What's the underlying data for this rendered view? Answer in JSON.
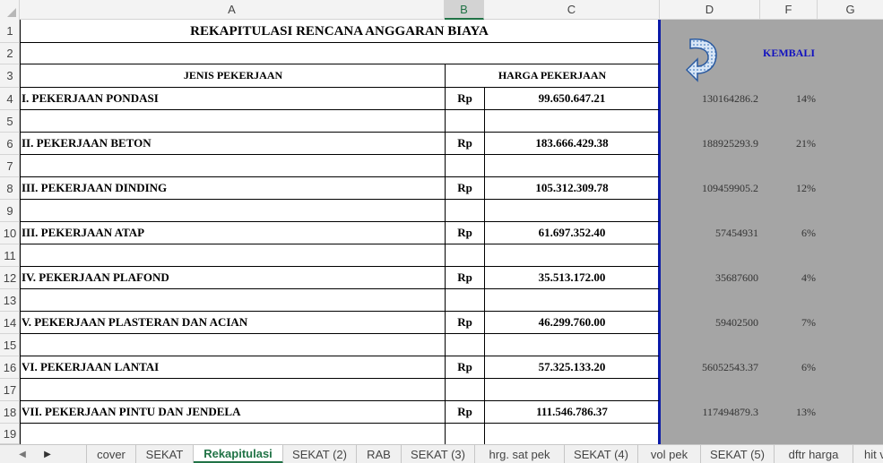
{
  "columns": [
    {
      "label": "A",
      "selected": false
    },
    {
      "label": "B",
      "selected": true
    },
    {
      "label": "C",
      "selected": false
    },
    {
      "label": "D",
      "selected": false
    },
    {
      "label": "F",
      "selected": false
    },
    {
      "label": "G",
      "selected": false
    }
  ],
  "rows": [
    "1",
    "2",
    "3",
    "4",
    "5",
    "6",
    "7",
    "8",
    "9",
    "10",
    "11",
    "12",
    "13",
    "14",
    "15",
    "16",
    "17",
    "18",
    "19"
  ],
  "sheet": {
    "title": "REKAPITULASI RENCANA ANGGARAN BIAYA",
    "header_jenis": "JENIS PEKERJAAN",
    "header_harga": "HARGA PEKERJAAN",
    "items": [
      {
        "name": "I. PEKERJAAN PONDASI",
        "currency": "Rp",
        "amount": "99.650.647.21",
        "d_value": "130164286.2",
        "percent": "14%"
      },
      {
        "name": "II. PEKERJAAN BETON",
        "currency": "Rp",
        "amount": "183.666.429.38",
        "d_value": "188925293.9",
        "percent": "21%"
      },
      {
        "name": "III. PEKERJAAN DINDING",
        "currency": "Rp",
        "amount": "105.312.309.78",
        "d_value": "109459905.2",
        "percent": "12%"
      },
      {
        "name": "III. PEKERJAAN ATAP",
        "currency": "Rp",
        "amount": "61.697.352.40",
        "d_value": "57454931",
        "percent": "6%"
      },
      {
        "name": "IV. PEKERJAAN PLAFOND",
        "currency": "Rp",
        "amount": "35.513.172.00",
        "d_value": "35687600",
        "percent": "4%"
      },
      {
        "name": "V. PEKERJAAN PLASTERAN DAN ACIAN",
        "currency": "Rp",
        "amount": "46.299.760.00",
        "d_value": "59402500",
        "percent": "7%"
      },
      {
        "name": "VI. PEKERJAAN LANTAI",
        "currency": "Rp",
        "amount": "57.325.133.20",
        "d_value": "56052543.37",
        "percent": "6%"
      },
      {
        "name": "VII. PEKERJAAN PINTU DAN JENDELA",
        "currency": "Rp",
        "amount": "111.546.786.37",
        "d_value": "117494879.3",
        "percent": "13%"
      }
    ]
  },
  "kembali_label": "KEMBALI",
  "tabs": [
    {
      "label": "cover",
      "active": false
    },
    {
      "label": "SEKAT",
      "active": false
    },
    {
      "label": "Rekapitulasi",
      "active": true
    },
    {
      "label": "SEKAT (2)",
      "active": false
    },
    {
      "label": "RAB",
      "active": false
    },
    {
      "label": "SEKAT (3)",
      "active": false
    },
    {
      "label": "hrg. sat pek",
      "active": false
    },
    {
      "label": "SEKAT (4)",
      "active": false
    },
    {
      "label": "vol pek",
      "active": false
    },
    {
      "label": "SEKAT (5)",
      "active": false
    },
    {
      "label": "dftr harga",
      "active": false
    },
    {
      "label": "hit v",
      "active": false
    }
  ],
  "colors": {
    "accent": "#217346",
    "gray_area": "#a5a5a5",
    "blue_border": "#0a1aa8",
    "link": "#1010c0"
  }
}
